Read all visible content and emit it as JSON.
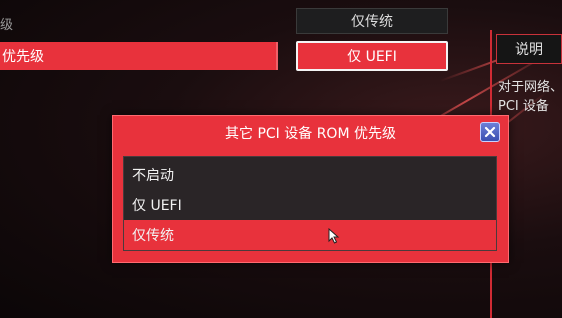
{
  "page": {
    "left_edge_text": "级",
    "left_row_label": "优先级"
  },
  "options": {
    "top_value": "仅传统",
    "selected_value": "仅 UEFI"
  },
  "help": {
    "title": "说明",
    "text": "对于网络、\nPCI 设备"
  },
  "dialog": {
    "title": "其它 PCI 设备 ROM 优先级",
    "items": [
      {
        "label": "不启动"
      },
      {
        "label": "仅 UEFI"
      },
      {
        "label": "仅传统"
      }
    ],
    "selected_index": 2
  },
  "colors": {
    "accent": "#e8323c",
    "background": "#1a0d0f",
    "close_button": "#4a5fc0"
  }
}
